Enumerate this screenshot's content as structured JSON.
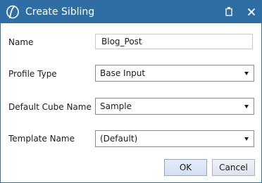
{
  "window": {
    "title": "Create Sibling",
    "icons": {
      "app": "app-logo-icon",
      "restore": "restore-icon",
      "close": "close-icon"
    },
    "colors": {
      "titlebar": "#2f6ea5"
    }
  },
  "form": {
    "name": {
      "label": "Name",
      "value": "Blog_Post"
    },
    "profile_type": {
      "label": "Profile Type",
      "value": "Base Input"
    },
    "default_cube_name": {
      "label": "Default Cube Name",
      "value": "Sample"
    },
    "template_name": {
      "label": "Template Name",
      "value": "(Default)"
    }
  },
  "buttons": {
    "ok": "OK",
    "cancel": "Cancel"
  }
}
